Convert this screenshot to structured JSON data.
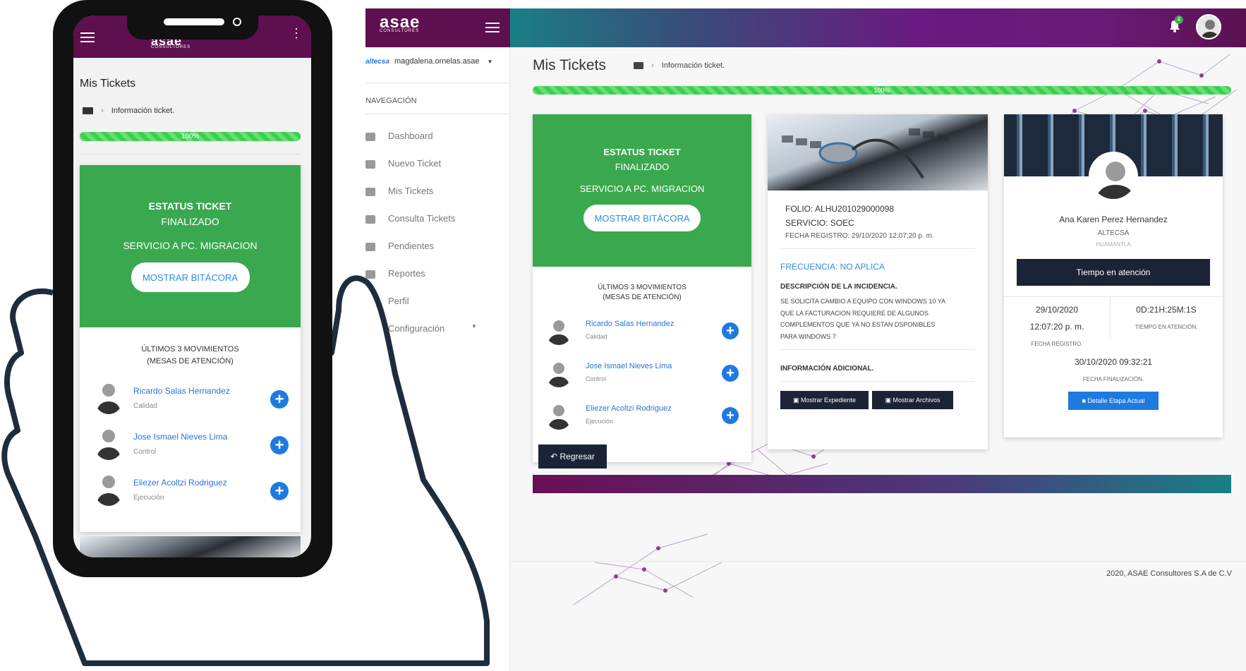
{
  "brand": {
    "name": "asae",
    "sub": "CONSULTORES"
  },
  "topbar": {
    "notification_count": "4"
  },
  "sidebar": {
    "company_logo": "altecsa",
    "user": "magdalena.ornelas.asae",
    "section": "NAVEGACIÓN",
    "items": [
      {
        "label": "Dashboard",
        "icon": "pie-chart-icon"
      },
      {
        "label": "Nuevo Ticket",
        "icon": "ticket-icon"
      },
      {
        "label": "Mis Tickets",
        "icon": "folder-icon"
      },
      {
        "label": "Consulta Tickets",
        "icon": "search-icon"
      },
      {
        "label": "Pendientes",
        "icon": "pending-icon"
      },
      {
        "label": "Reportes",
        "icon": "report-icon"
      },
      {
        "label": "Perfil",
        "icon": "user-icon"
      },
      {
        "label": "Configuración",
        "icon": "gear-icon"
      }
    ]
  },
  "page": {
    "title": "Mis Tickets",
    "breadcrumb": "Información ticket.",
    "progress_label": "100%",
    "progress": 1.0
  },
  "status_card": {
    "line1": "ESTATUS TICKET",
    "line2": "FINALIZADO",
    "service": "SERVICIO A PC. MIGRACION",
    "button": "MOSTRAR BITÁCORA"
  },
  "movements": {
    "title1": "ÚLTIMOS 3 MOVIMIENTOS",
    "title2": "(MESAS DE ATENCIÓN)",
    "rows": [
      {
        "name": "Ricardo Salas Hernandez",
        "role": "Calidad"
      },
      {
        "name": "Jose Ismael Nieves Lima",
        "role": "Control"
      },
      {
        "name": "Eliezer Acoltzi Rodriguez",
        "role": "Ejecución"
      }
    ]
  },
  "ticket_card": {
    "folio": "FOLIO: ALHU201029000098",
    "servicio": "SERVICIO: SOEC",
    "fecha": "FECHA REGISTRO: 29/10/2020 12:07:20 p. m.",
    "frecuencia": "FRECUENCIA: NO APLICA",
    "desc_title": "DESCRIPCIÓN DE LA INCIDENCIA.",
    "desc_lines": [
      "SE SOLICITA CAMBIO A EQUIPO CON WINDOWS 10 YA",
      "QUE LA FACTURACION REQUIERE DE ALGUNOS",
      "COMPLEMENTOS QUE YA NO ESTAN DSPONIBLES",
      "PARA WINDOWS 7"
    ],
    "info_title": "INFORMACIÓN ADICIONAL.",
    "btn_expediente": "Mostrar Expediente",
    "btn_archivos": "Mostrar Archivos"
  },
  "agent_card": {
    "name": "Ana Karen Perez Hernandez",
    "company": "ALTECSA",
    "location": "HUAMANTLA",
    "button": "Tiempo en atención",
    "reg_date": "29/10/2020",
    "reg_time": "12:07:20 p. m.",
    "reg_label": "FECHA REGISTRO.",
    "time": "0D:21H:25M:1S",
    "time_label": "TIEMPO EN ATENCIÓN.",
    "fin_date": "30/10/2020 09:32:21",
    "fin_label": "FECHA FINALIZACIÓN.",
    "detail_btn": "Detalle Etapa Actual"
  },
  "back_button": "Regresar",
  "footer": "2020, ASAE Consultores S.A de C.V",
  "colors": {
    "green": "#3aa84f",
    "blue": "#1f7ae0",
    "dark": "#1b2336",
    "purple": "#5e0f4f"
  }
}
